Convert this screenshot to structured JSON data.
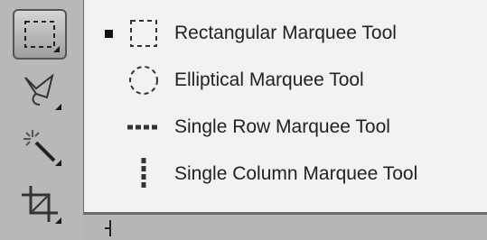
{
  "toolbar": {
    "tools": [
      {
        "icon": "rectangular-marquee-icon",
        "active": true
      },
      {
        "icon": "lasso-icon",
        "active": false
      },
      {
        "icon": "magic-wand-icon",
        "active": false
      },
      {
        "icon": "crop-icon",
        "active": false
      }
    ]
  },
  "flyout_menu": {
    "items": [
      {
        "label": "Rectangular Marquee Tool",
        "icon": "rectangular-marquee-icon",
        "selected": true
      },
      {
        "label": "Elliptical Marquee Tool",
        "icon": "elliptical-marquee-icon",
        "selected": false
      },
      {
        "label": "Single Row Marquee Tool",
        "icon": "single-row-marquee-icon",
        "selected": false
      },
      {
        "label": "Single Column Marquee Tool",
        "icon": "single-column-marquee-icon",
        "selected": false
      }
    ]
  },
  "colors": {
    "menu_background": "#f2f2f2",
    "toolbar_background": "#b8b8b8",
    "text": "#222222"
  }
}
